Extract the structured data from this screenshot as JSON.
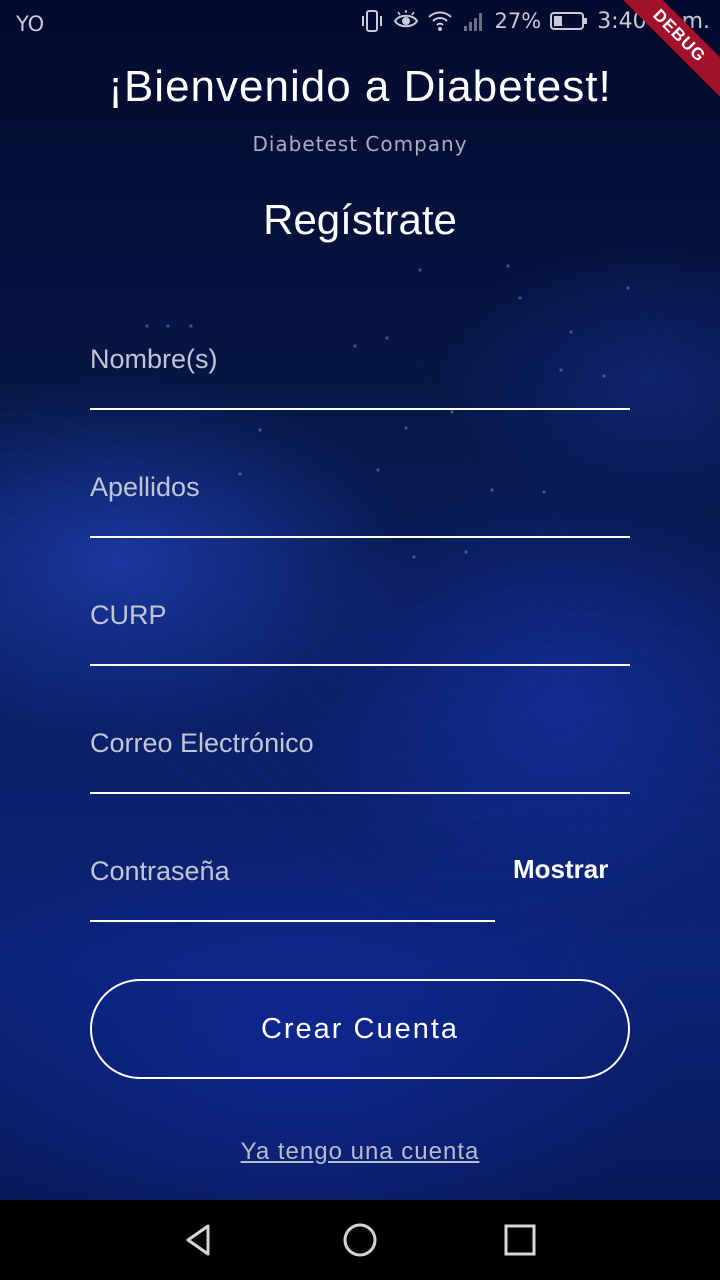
{
  "status_bar": {
    "carrier": "YO",
    "battery": "27%",
    "time": "3:40 p. m.",
    "icons": [
      "vibrate-icon",
      "eye-icon",
      "wifi-icon",
      "signal-icon",
      "battery-icon"
    ]
  },
  "debug_banner": "DEBUG",
  "header": {
    "welcome": "¡Bienvenido a Diabetest!",
    "company": "Diabetest Company",
    "title": "Regístrate"
  },
  "form": {
    "nombre_placeholder": "Nombre(s)",
    "apellidos_placeholder": "Apellidos",
    "curp_placeholder": "CURP",
    "email_placeholder": "Correo Electrónico",
    "password_placeholder": "Contraseña",
    "show_password_label": "Mostrar",
    "submit_label": "Crear Cuenta",
    "login_link": "Ya tengo una cuenta"
  },
  "nav_bar": {
    "icons": [
      "back-triangle-icon",
      "home-circle-icon",
      "recents-square-icon"
    ]
  },
  "colors": {
    "background_top": "#030b2e",
    "background_bottom": "#0b2377",
    "debug_ribbon": "#a3122a",
    "text_primary": "#ffffff",
    "text_secondary": "#c2c6d4"
  }
}
